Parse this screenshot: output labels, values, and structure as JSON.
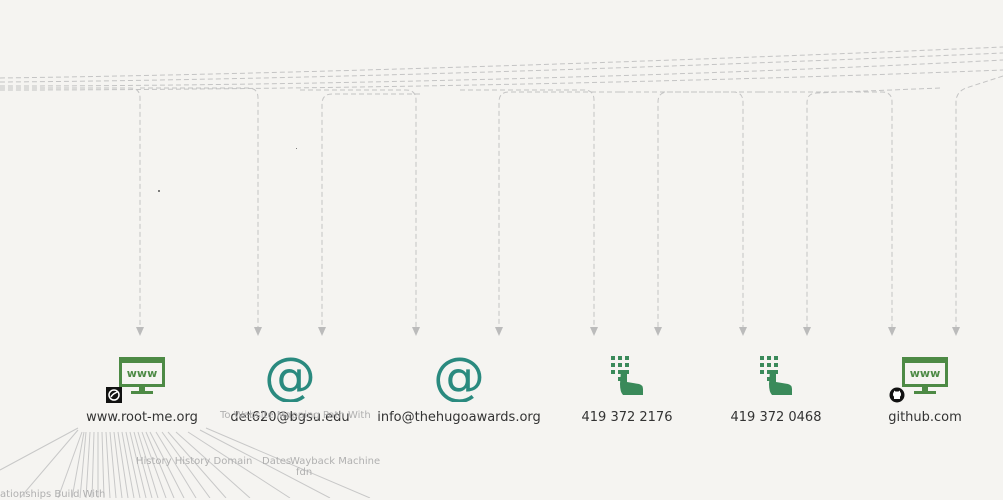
{
  "nodes": [
    {
      "id": "n1",
      "type": "website",
      "label": "www.root-me.org",
      "icon": "www-icon",
      "badge": "root-me-logo"
    },
    {
      "id": "n2",
      "type": "email",
      "label": "det620@bgsu.edu",
      "icon": "at-sign-icon"
    },
    {
      "id": "n3",
      "type": "email",
      "label": "info@thehugoawards.org",
      "icon": "at-sign-icon"
    },
    {
      "id": "n4",
      "type": "phone",
      "label": "419 372 2176",
      "icon": "keypad-icon"
    },
    {
      "id": "n5",
      "type": "phone",
      "label": "419 372 0468",
      "icon": "keypad-icon"
    },
    {
      "id": "n6",
      "type": "website",
      "label": "github.com",
      "icon": "www-icon",
      "badge": "github-icon"
    }
  ],
  "faded_labels": {
    "to_website": "To Website Mapping Path With",
    "wayback": "Wayback Machine",
    "dates": "Dates",
    "history": "History History Domain",
    "fdn": "fdn",
    "relationships": "ationships Build With"
  },
  "colors": {
    "www": "#4d8a45",
    "at_sign": "#2a8a7f",
    "keypad": "#3a8a5a",
    "edge": "#c4c4c4",
    "background": "#f5f4f1"
  }
}
